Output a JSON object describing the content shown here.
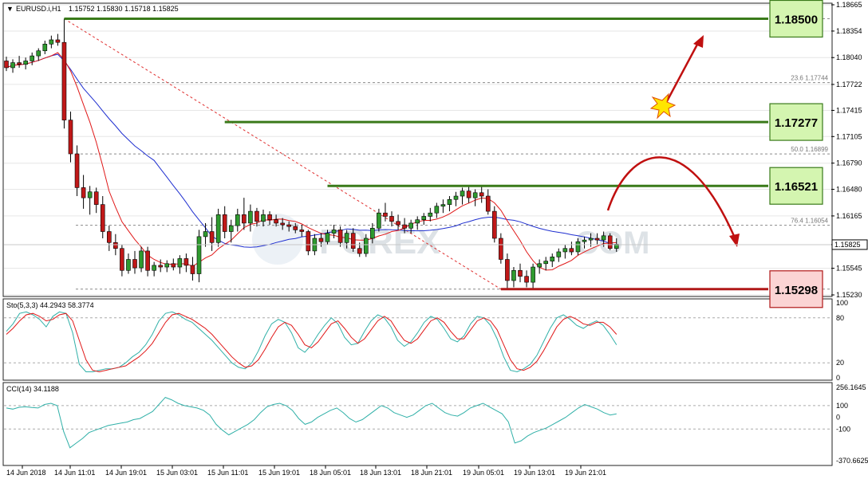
{
  "chart_data": {
    "type": "candlestick",
    "header": {
      "symbol": "EURUSD.i,H1",
      "ohlc": "1.15752 1.15830 1.15718 1.15825"
    },
    "price_axis": {
      "min": 1.1523,
      "max": 1.18665,
      "ticks": [
        "1.18665",
        "1.18354",
        "1.18040",
        "1.17722",
        "1.17415",
        "1.17105",
        "1.16790",
        "1.16480",
        "1.16165",
        "1.15825",
        "1.15545",
        "1.15230"
      ],
      "current_price": "1.15825"
    },
    "time_labels": [
      "14 Jun 2018",
      "14 Jun 11:01",
      "14 Jun 19:01",
      "15 Jun 03:01",
      "15 Jun 11:01",
      "15 Jun 19:01",
      "18 Jun 05:01",
      "18 Jun 13:01",
      "18 Jun 21:01",
      "19 Jun 05:01",
      "19 Jun 13:01",
      "19 Jun 21:01"
    ],
    "candles": [
      [
        1.18,
        1.1805,
        1.1788,
        1.1792
      ],
      [
        1.1792,
        1.1802,
        1.1786,
        1.1798
      ],
      [
        1.1798,
        1.1806,
        1.1792,
        1.1796
      ],
      [
        1.1796,
        1.1804,
        1.179,
        1.18
      ],
      [
        1.18,
        1.181,
        1.1795,
        1.1806
      ],
      [
        1.1806,
        1.1815,
        1.18,
        1.1812
      ],
      [
        1.1812,
        1.1824,
        1.1808,
        1.182
      ],
      [
        1.182,
        1.183,
        1.1815,
        1.1825
      ],
      [
        1.1825,
        1.1832,
        1.1818,
        1.1822
      ],
      [
        1.1822,
        1.185,
        1.172,
        1.173
      ],
      [
        1.173,
        1.174,
        1.168,
        1.169
      ],
      [
        1.169,
        1.17,
        1.164,
        1.165
      ],
      [
        1.165,
        1.1665,
        1.1625,
        1.1638
      ],
      [
        1.1638,
        1.1652,
        1.1618,
        1.1645
      ],
      [
        1.1645,
        1.165,
        1.162,
        1.163
      ],
      [
        1.163,
        1.164,
        1.159,
        1.1598
      ],
      [
        1.1598,
        1.1605,
        1.1575,
        1.1585
      ],
      [
        1.1585,
        1.1595,
        1.157,
        1.1578
      ],
      [
        1.1578,
        1.1582,
        1.1545,
        1.1552
      ],
      [
        1.1552,
        1.1572,
        1.1548,
        1.1565
      ],
      [
        1.1565,
        1.1575,
        1.1548,
        1.1555
      ],
      [
        1.1555,
        1.158,
        1.155,
        1.1575
      ],
      [
        1.1575,
        1.158,
        1.1545,
        1.1552
      ],
      [
        1.1552,
        1.1562,
        1.1545,
        1.1558
      ],
      [
        1.1558,
        1.1565,
        1.155,
        1.1556
      ],
      [
        1.1556,
        1.1564,
        1.155,
        1.156
      ],
      [
        1.156,
        1.1566,
        1.1552,
        1.1556
      ],
      [
        1.1556,
        1.157,
        1.1548,
        1.1566
      ],
      [
        1.1566,
        1.1572,
        1.155,
        1.1558
      ],
      [
        1.1558,
        1.1568,
        1.154,
        1.1548
      ],
      [
        1.1548,
        1.16,
        1.1538,
        1.1592
      ],
      [
        1.1592,
        1.1608,
        1.158,
        1.1598
      ],
      [
        1.1598,
        1.1615,
        1.1575,
        1.1585
      ],
      [
        1.1585,
        1.1625,
        1.158,
        1.1618
      ],
      [
        1.1618,
        1.1628,
        1.159,
        1.1598
      ],
      [
        1.1598,
        1.1612,
        1.1585,
        1.1605
      ],
      [
        1.1605,
        1.1625,
        1.1598,
        1.1618
      ],
      [
        1.1618,
        1.1638,
        1.16,
        1.1608
      ],
      [
        1.1608,
        1.163,
        1.1598,
        1.1622
      ],
      [
        1.1622,
        1.1626,
        1.1604,
        1.161
      ],
      [
        1.161,
        1.1624,
        1.1604,
        1.1618
      ],
      [
        1.1618,
        1.1622,
        1.1606,
        1.1612
      ],
      [
        1.1612,
        1.1618,
        1.1604,
        1.1608
      ],
      [
        1.1608,
        1.1614,
        1.16,
        1.1606
      ],
      [
        1.1606,
        1.161,
        1.1598,
        1.1604
      ],
      [
        1.1604,
        1.1608,
        1.1596,
        1.16
      ],
      [
        1.16,
        1.1606,
        1.1592,
        1.1598
      ],
      [
        1.1598,
        1.16,
        1.157,
        1.1575
      ],
      [
        1.1575,
        1.1595,
        1.157,
        1.159
      ],
      [
        1.159,
        1.1596,
        1.158,
        1.1586
      ],
      [
        1.1586,
        1.16,
        1.1582,
        1.1596
      ],
      [
        1.1596,
        1.1606,
        1.159,
        1.16
      ],
      [
        1.16,
        1.1604,
        1.158,
        1.1585
      ],
      [
        1.1585,
        1.16,
        1.1578,
        1.1596
      ],
      [
        1.1596,
        1.1602,
        1.1574,
        1.1578
      ],
      [
        1.1578,
        1.1585,
        1.1568,
        1.1572
      ],
      [
        1.1572,
        1.1595,
        1.1568,
        1.159
      ],
      [
        1.159,
        1.1608,
        1.1584,
        1.1602
      ],
      [
        1.1602,
        1.1625,
        1.1598,
        1.162
      ],
      [
        1.162,
        1.1632,
        1.161,
        1.1616
      ],
      [
        1.1616,
        1.1622,
        1.1604,
        1.161
      ],
      [
        1.161,
        1.1618,
        1.16,
        1.1606
      ],
      [
        1.1606,
        1.1614,
        1.1596,
        1.1602
      ],
      [
        1.1602,
        1.1612,
        1.1596,
        1.1608
      ],
      [
        1.1608,
        1.1616,
        1.16,
        1.1612
      ],
      [
        1.1612,
        1.162,
        1.1606,
        1.1616
      ],
      [
        1.1616,
        1.1626,
        1.161,
        1.162
      ],
      [
        1.162,
        1.1632,
        1.1614,
        1.1628
      ],
      [
        1.1628,
        1.1636,
        1.162,
        1.163
      ],
      [
        1.163,
        1.164,
        1.1622,
        1.1636
      ],
      [
        1.1636,
        1.1645,
        1.1628,
        1.164
      ],
      [
        1.164,
        1.165,
        1.163,
        1.1646
      ],
      [
        1.1646,
        1.1652,
        1.1632,
        1.1638
      ],
      [
        1.1638,
        1.1648,
        1.1628,
        1.1644
      ],
      [
        1.1644,
        1.1652,
        1.1632,
        1.164
      ],
      [
        1.164,
        1.1648,
        1.1618,
        1.1622
      ],
      [
        1.1622,
        1.1628,
        1.1585,
        1.159
      ],
      [
        1.159,
        1.1596,
        1.156,
        1.1565
      ],
      [
        1.1565,
        1.1572,
        1.153,
        1.154
      ],
      [
        1.154,
        1.1556,
        1.1532,
        1.1552
      ],
      [
        1.1552,
        1.156,
        1.1538,
        1.1545
      ],
      [
        1.1545,
        1.1552,
        1.1532,
        1.1538
      ],
      [
        1.1538,
        1.156,
        1.153,
        1.1556
      ],
      [
        1.1556,
        1.1565,
        1.1548,
        1.156
      ],
      [
        1.156,
        1.1568,
        1.1552,
        1.1563
      ],
      [
        1.1563,
        1.1572,
        1.1556,
        1.1568
      ],
      [
        1.1568,
        1.1578,
        1.1562,
        1.1574
      ],
      [
        1.1574,
        1.1582,
        1.1566,
        1.1578
      ],
      [
        1.1578,
        1.1586,
        1.157,
        1.1574
      ],
      [
        1.1574,
        1.159,
        1.157,
        1.1586
      ],
      [
        1.1586,
        1.1592,
        1.1578,
        1.1588
      ],
      [
        1.1588,
        1.1596,
        1.158,
        1.159
      ],
      [
        1.159,
        1.1596,
        1.1582,
        1.1588
      ],
      [
        1.1588,
        1.1598,
        1.158,
        1.1593
      ],
      [
        1.1593,
        1.1596,
        1.1576,
        1.1578
      ],
      [
        1.1578,
        1.159,
        1.1574,
        1.1583
      ]
    ],
    "levels": [
      {
        "name": "level-1.18500",
        "value": 1.185,
        "label": "1.18500",
        "x_start_index": 9,
        "color": "#3a7a1a",
        "box_fill": "#d4f5b0"
      },
      {
        "name": "level-1.17277",
        "value": 1.17277,
        "label": "1.17277",
        "x_start_index": 34,
        "color": "#3a7a1a",
        "box_fill": "#d4f5b0"
      },
      {
        "name": "level-1.16521",
        "value": 1.16521,
        "label": "1.16521",
        "x_start_index": 50,
        "color": "#3a7a1a",
        "box_fill": "#d4f5b0"
      },
      {
        "name": "level-1.15298",
        "value": 1.15298,
        "label": "1.15298",
        "x_start_index": 77,
        "color": "#b01818",
        "box_fill": "#fbd4d4"
      }
    ],
    "fibo_levels": [
      {
        "label": "23.6 1.17744",
        "value": 1.17744
      },
      {
        "label": "50.0 1.16899",
        "value": 1.16899
      },
      {
        "label": "76.4 1.16054",
        "value": 1.16054
      }
    ],
    "watermark": "FOREX",
    "watermark2": ".COM",
    "stochastic": {
      "label": "Sto(5,3,3) 44.2943 58.3774",
      "ticks": [
        "100",
        "80",
        "20",
        "0"
      ],
      "main": [
        62,
        72,
        86,
        88,
        84,
        78,
        68,
        82,
        88,
        86,
        60,
        18,
        8,
        8,
        10,
        12,
        12,
        14,
        20,
        28,
        34,
        44,
        58,
        76,
        86,
        88,
        84,
        78,
        74,
        66,
        58,
        50,
        40,
        30,
        20,
        14,
        12,
        20,
        36,
        56,
        72,
        78,
        74,
        60,
        40,
        34,
        44,
        58,
        70,
        80,
        72,
        54,
        44,
        46,
        62,
        76,
        84,
        80,
        68,
        50,
        42,
        48,
        60,
        74,
        82,
        78,
        66,
        52,
        48,
        56,
        72,
        82,
        80,
        70,
        52,
        28,
        10,
        8,
        12,
        18,
        30,
        48,
        66,
        80,
        84,
        78,
        70,
        66,
        72,
        76,
        70,
        58,
        44
      ],
      "signal": [
        58,
        66,
        76,
        84,
        86,
        82,
        76,
        78,
        84,
        86,
        76,
        50,
        24,
        10,
        8,
        10,
        12,
        14,
        16,
        22,
        28,
        36,
        46,
        60,
        74,
        84,
        86,
        82,
        78,
        72,
        66,
        58,
        48,
        38,
        28,
        20,
        14,
        16,
        24,
        38,
        54,
        68,
        74,
        70,
        58,
        44,
        40,
        48,
        60,
        72,
        76,
        66,
        54,
        46,
        52,
        64,
        76,
        82,
        76,
        62,
        50,
        46,
        52,
        64,
        76,
        80,
        74,
        62,
        52,
        52,
        64,
        76,
        80,
        76,
        64,
        44,
        24,
        12,
        10,
        14,
        22,
        36,
        52,
        68,
        78,
        82,
        78,
        72,
        70,
        74,
        74,
        68,
        58
      ]
    },
    "cci": {
      "label": "CCI(14) 34.1188",
      "ticks": [
        "256.1645",
        "100",
        "0",
        "-100",
        "-370.6625"
      ],
      "min": -370.6625,
      "max": 256.1645,
      "values": [
        80,
        70,
        86,
        90,
        84,
        80,
        110,
        120,
        100,
        -120,
        -260,
        -220,
        -180,
        -130,
        -110,
        -90,
        -70,
        -60,
        -50,
        -40,
        -20,
        -10,
        20,
        50,
        110,
        170,
        150,
        120,
        100,
        90,
        80,
        60,
        20,
        -60,
        -110,
        -150,
        -120,
        -90,
        -60,
        -20,
        40,
        90,
        110,
        120,
        100,
        60,
        -10,
        -60,
        -40,
        0,
        30,
        60,
        80,
        40,
        -10,
        -40,
        -20,
        20,
        60,
        100,
        80,
        40,
        20,
        0,
        20,
        60,
        100,
        120,
        80,
        40,
        20,
        10,
        40,
        80,
        100,
        120,
        90,
        60,
        30,
        -40,
        -220,
        -200,
        -160,
        -130,
        -110,
        -90,
        -60,
        -30,
        0,
        40,
        80,
        110,
        90,
        70,
        40,
        20,
        30
      ]
    }
  }
}
